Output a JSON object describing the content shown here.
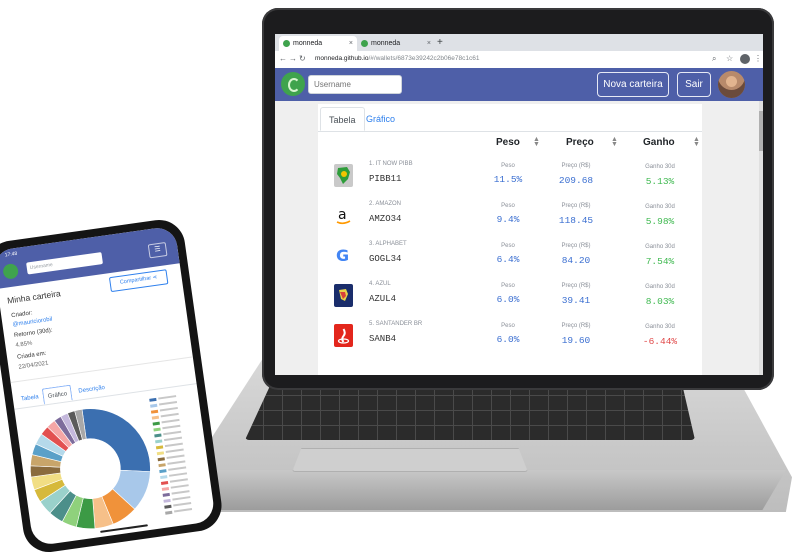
{
  "browser": {
    "tabs": [
      {
        "title": "monneda",
        "close": "×"
      },
      {
        "title": "monneda",
        "close": "×"
      }
    ],
    "new_tab": "+",
    "url_host": "monneda.github.io",
    "url_path": "/#/wallets/6873e39242c2b06e78c1c61"
  },
  "app": {
    "username_placeholder": "Username",
    "new_wallet_label": "Nova carteira",
    "logout_label": "Sair",
    "tabs": {
      "table": "Tabela",
      "chart": "Gráfico"
    },
    "columns": {
      "weight": "Peso",
      "price": "Preço",
      "gain": "Ganho"
    },
    "rows": [
      {
        "name": "1. IT NOW PIBB",
        "ticker": "PIBB11",
        "weight_label": "Peso",
        "weight": "11.5%",
        "price_label": "Preço (R$)",
        "price": "209.68",
        "gain_label": "Ganho 30d",
        "gain": "5.13%",
        "gain_sign": "positive",
        "logo_color": "#c9c9c9"
      },
      {
        "name": "2. AMAZON",
        "ticker": "AMZO34",
        "weight_label": "Peso",
        "weight": "9.4%",
        "price_label": "Preço (R$)",
        "price": "118.45",
        "gain_label": "Ganho 30d",
        "gain": "5.98%",
        "gain_sign": "positive",
        "logo_color": "#ffffff"
      },
      {
        "name": "3. ALPHABET",
        "ticker": "GOGL34",
        "weight_label": "Peso",
        "weight": "6.4%",
        "price_label": "Preço (R$)",
        "price": "84.20",
        "gain_label": "Ganho 30d",
        "gain": "7.54%",
        "gain_sign": "positive",
        "logo_color": "#ffffff"
      },
      {
        "name": "4. AZUL",
        "ticker": "AZUL4",
        "weight_label": "Peso",
        "weight": "6.0%",
        "price_label": "Preço (R$)",
        "price": "39.41",
        "gain_label": "Ganho 30d",
        "gain": "8.03%",
        "gain_sign": "positive",
        "logo_color": "#1a2d6b"
      },
      {
        "name": "5. SANTANDER BR",
        "ticker": "SANB4",
        "weight_label": "Peso",
        "weight": "6.0%",
        "price_label": "Preço (R$)",
        "price": "19.60",
        "gain_label": "Ganho 30d",
        "gain": "-6.44%",
        "gain_sign": "negative",
        "logo_color": "#e3261c"
      }
    ]
  },
  "phone": {
    "status_time": "17:48",
    "username_placeholder": "Username",
    "menu_icon": "☰",
    "title": "Minha carteira",
    "share_label": "Compartilhar",
    "creator_label": "Criador:",
    "creator_value": "@mauriciorobil",
    "return_label": "Retorno (30d):",
    "return_value": "4.85%",
    "created_label": "Criada em:",
    "created_value": "22/04/2021",
    "tabs": {
      "table": "Tabela",
      "chart": "Gráfico",
      "description": "Descrição"
    }
  },
  "colors": {
    "navbar": "#4e5fa8",
    "positive": "#3fb950",
    "negative": "#e04848",
    "value_blue": "#3b6fd1",
    "link": "#2f80ed",
    "brand_green": "#3fa34d"
  },
  "chart_data": {
    "type": "pie",
    "variant": "donut",
    "series": [
      {
        "values": [
          28,
          11,
          7,
          5,
          5,
          4,
          4,
          4,
          3.5,
          3.5,
          3,
          3,
          3,
          3,
          2.5,
          2.5,
          2,
          2,
          2,
          2
        ]
      }
    ],
    "colors": [
      "#3b6fb0",
      "#a8c8ea",
      "#f0923a",
      "#f6c089",
      "#3c9a45",
      "#8fd17c",
      "#4c8f8a",
      "#9ad1cb",
      "#d6b93b",
      "#f1de84",
      "#8a6b3d",
      "#c8a56a",
      "#5aa0c8",
      "#b5d9ea",
      "#e25050",
      "#f5a6a6",
      "#7d6c9c",
      "#c4b8dc",
      "#5b5b5b",
      "#a8a8a8"
    ]
  }
}
